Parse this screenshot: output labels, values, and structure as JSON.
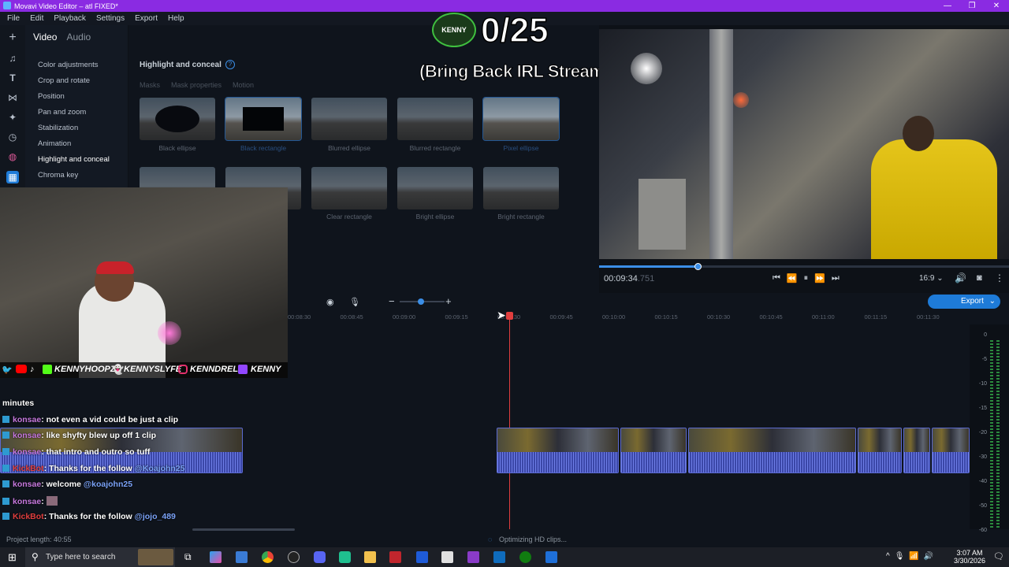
{
  "window": {
    "title": "Movavi Video Editor – atl FIXED*",
    "controls": [
      "—",
      "❐",
      "✕"
    ]
  },
  "menu": [
    "File",
    "Edit",
    "Playback",
    "Settings",
    "Export",
    "Help"
  ],
  "overlay": {
    "counter": "0/25",
    "subtitle": "(Bring Back IRL Streams)",
    "badge": "KENNY"
  },
  "tabs": {
    "video": "Video",
    "audio": "Audio"
  },
  "categories": [
    "Color adjustments",
    "Crop and rotate",
    "Position",
    "Pan and zoom",
    "Stabilization",
    "Animation",
    "Highlight and conceal",
    "Chroma key"
  ],
  "effects": {
    "title": "Highlight and conceal",
    "subtabs": [
      "Masks",
      "Mask properties",
      "Motion"
    ],
    "row1": [
      "Black ellipse",
      "Black rectangle",
      "Blurred ellipse",
      "Blurred rectangle",
      "Pixel ellipse"
    ],
    "row2": [
      "Clear rectangle",
      "Bright ellipse",
      "Bright rectangle"
    ]
  },
  "player": {
    "time": "00:09:34",
    "frames": ".751",
    "aspect": "16:9",
    "progress": 0.24
  },
  "timeline": {
    "ruler": [
      "00:08:30",
      "00:08:45",
      "00:09:00",
      "00:09:15",
      "00:09:30",
      "00:09:45",
      "00:10:00",
      "00:10:15",
      "00:10:30",
      "00:10:45",
      "00:11:00",
      "00:11:15",
      "00:11:30"
    ],
    "export_label": "Export"
  },
  "socials": [
    "KENNYHOOPZ",
    "KENNYSLYFE",
    "KENNDRELL",
    "KENNY"
  ],
  "chat": {
    "header": "minutes",
    "messages": [
      {
        "user": "konsae",
        "text": ": not even a vid could be just a clip"
      },
      {
        "user": "konsae",
        "text": ": like shyfty blew up off 1 clip"
      },
      {
        "user": "konsae",
        "text": ": that intro and outro so tuff"
      },
      {
        "user": "KickBot",
        "text": ": Thanks for the follow ",
        "mention": "@Koajohn25"
      },
      {
        "user": "konsae",
        "text": ": welcome ",
        "mention": "@koajohn25"
      },
      {
        "user": "konsae",
        "text": ": "
      },
      {
        "user": "KickBot",
        "text": ": Thanks for the follow ",
        "mention": "@jojo_489"
      }
    ]
  },
  "vu": [
    "0",
    "-5",
    "-10",
    "-15",
    "-20",
    "-30",
    "-40",
    "-50",
    "-60"
  ],
  "status": {
    "project_length": "Project length: 40:55",
    "optimizing": "Optimizing HD clips..."
  },
  "taskbar": {
    "search_placeholder": "Type here to search",
    "time": "3:07 AM",
    "date": "3/30/2026"
  }
}
